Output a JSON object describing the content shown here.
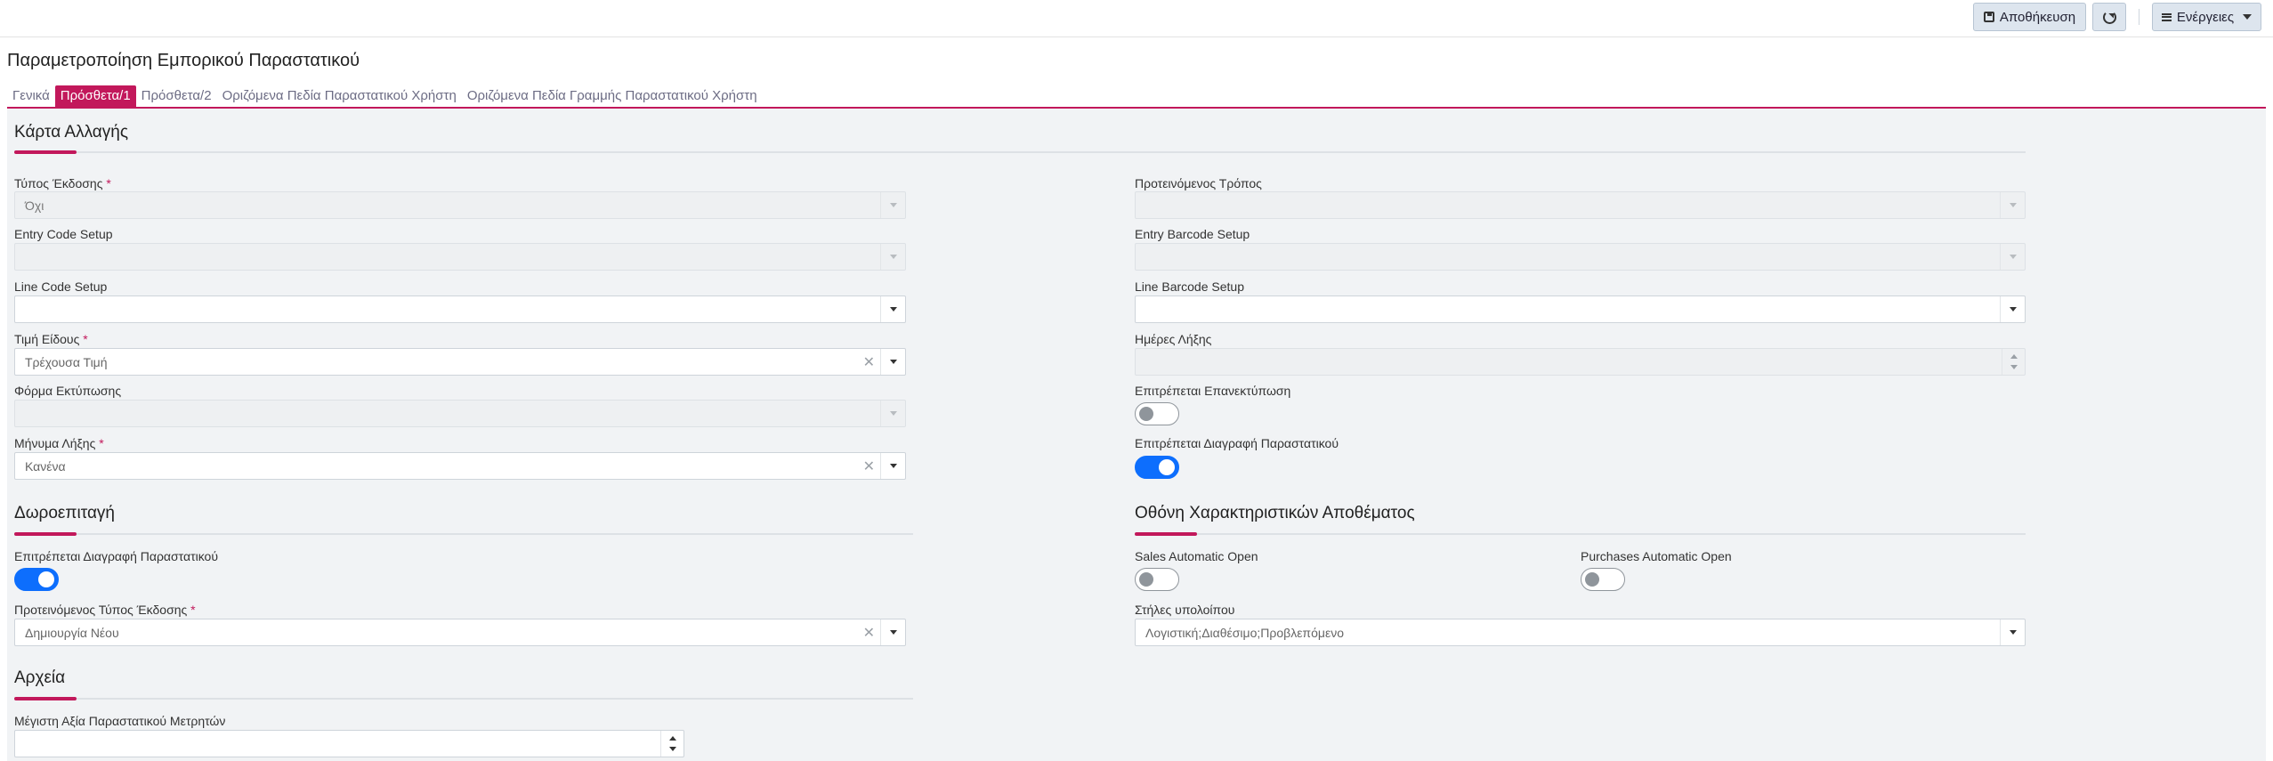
{
  "toolbar": {
    "save_label": "Αποθήκευση",
    "actions_label": "Ενέργειες"
  },
  "page_title": "Παραμετροποίηση Εμπορικού Παραστατικού",
  "tabs": [
    {
      "label": "Γενικά",
      "active": false
    },
    {
      "label": "Πρόσθετα/1",
      "active": true
    },
    {
      "label": "Πρόσθετα/2",
      "active": false
    },
    {
      "label": "Οριζόμενα Πεδία Παραστατικού Χρήστη",
      "active": false
    },
    {
      "label": "Οριζόμενα Πεδία Γραμμής Παραστατικού Χρήστη",
      "active": false
    }
  ],
  "sections": {
    "card_change": "Κάρτα Αλλαγής",
    "gift_voucher": "Δωροεπιταγή",
    "stock_screen": "Οθόνη Χαρακτηριστικών Αποθέματος",
    "files": "Αρχεία"
  },
  "fields": {
    "issue_type": {
      "label": "Τύπος Έκδοσης",
      "value": "Όχι"
    },
    "suggested_method": {
      "label": "Προτεινόμενος Τρόπος",
      "value": ""
    },
    "entry_code_setup": {
      "label": "Entry Code Setup",
      "value": ""
    },
    "entry_barcode_setup": {
      "label": "Entry Barcode Setup",
      "value": ""
    },
    "line_code_setup": {
      "label": "Line Code Setup",
      "value": ""
    },
    "line_barcode_setup": {
      "label": "Line Barcode Setup",
      "value": ""
    },
    "item_price": {
      "label": "Τιμή Είδους",
      "value": "Τρέχουσα Τιμή"
    },
    "expiry_days": {
      "label": "Ημέρες Λήξης",
      "value": ""
    },
    "print_form": {
      "label": "Φόρμα Εκτύπωσης",
      "value": ""
    },
    "allow_reprint": {
      "label": "Επιτρέπεται Επανεκτύπωση",
      "on": false
    },
    "expiry_message": {
      "label": "Μήνυμα Λήξης",
      "value": "Κανένα"
    },
    "allow_delete_doc": {
      "label": "Επιτρέπεται Διαγραφή Παραστατικού",
      "on": true
    },
    "gift_allow_delete": {
      "label": "Επιτρέπεται Διαγραφή Παραστατικού",
      "on": true
    },
    "gift_issue_type": {
      "label": "Προτεινόμενος Τύπος Έκδοσης",
      "value": "Δημιουργία Νέου"
    },
    "sales_auto_open": {
      "label": "Sales Automatic Open",
      "on": false
    },
    "purchases_auto_open": {
      "label": "Purchases Automatic Open",
      "on": false
    },
    "balance_columns": {
      "label": "Στήλες υπολοίπου",
      "value": "Λογιστική;Διαθέσιμο;Προβλεπόμενο"
    },
    "max_counter_value": {
      "label": "Μέγιστη Αξία Παραστατικού Μετρητών",
      "value": ""
    }
  },
  "required_mark": "*"
}
